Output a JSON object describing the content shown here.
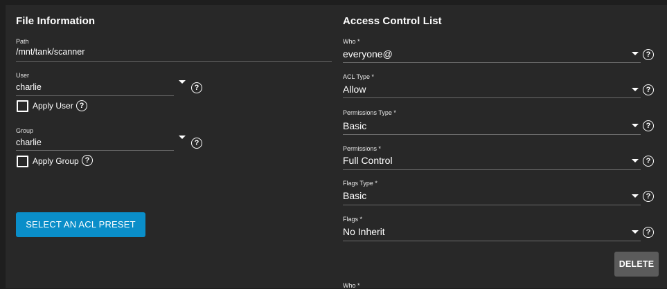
{
  "file_info": {
    "title": "File Information",
    "path": {
      "label": "Path",
      "value": "/mnt/tank/scanner"
    },
    "user": {
      "label": "User",
      "value": "charlie",
      "apply_label": "Apply User"
    },
    "group": {
      "label": "Group",
      "value": "charlie",
      "apply_label": "Apply Group"
    },
    "preset_button": "SELECT AN ACL PRESET"
  },
  "acl": {
    "title": "Access Control List",
    "fields": [
      {
        "label": "Who *",
        "value": "everyone@"
      },
      {
        "label": "ACL Type *",
        "value": "Allow"
      },
      {
        "label": "Permissions Type *",
        "value": "Basic"
      },
      {
        "label": "Permissions *",
        "value": "Full Control"
      },
      {
        "label": "Flags Type *",
        "value": "Basic"
      },
      {
        "label": "Flags *",
        "value": "No Inherit"
      }
    ],
    "delete_button": "DELETE",
    "next_entry_label": "Who *"
  },
  "icons": {
    "help": "help-circle-icon",
    "dropdown": "chevron-down-icon"
  },
  "colors": {
    "primary": "#0a8ec9",
    "card": "#282828",
    "background": "#1e1e1e",
    "delete": "#5b5b5b"
  }
}
